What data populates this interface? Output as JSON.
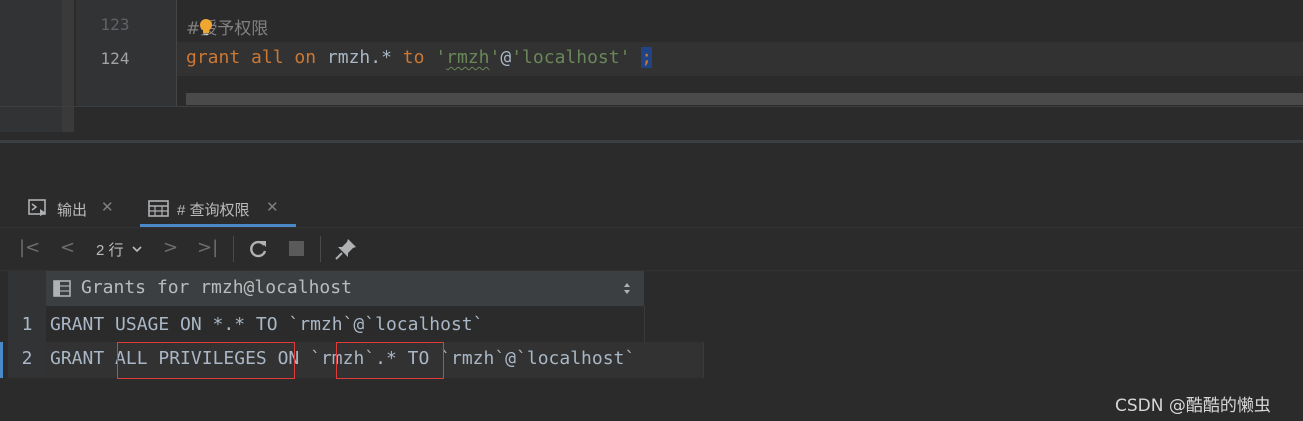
{
  "editor": {
    "lines": [
      {
        "number": "123",
        "text": "#授予权限"
      },
      {
        "number": "124",
        "tokens": {
          "kw1": "grant",
          "kw2": "all",
          "kw3": "on",
          "obj": "rmzh.*",
          "kw4": "to",
          "q1": "'",
          "user": "rmzh",
          "q2": "'",
          "at": "@",
          "host": "'localhost'",
          "semi": ";"
        }
      }
    ]
  },
  "tabs": [
    {
      "label": "输出",
      "icon": "console-output-icon"
    },
    {
      "label": "# 查询权限",
      "icon": "table-icon",
      "active": true
    }
  ],
  "toolbar": {
    "rows_label": "2 行"
  },
  "grid": {
    "column": "Grants for rmzh@localhost",
    "rows": [
      {
        "num": "1",
        "text": "GRANT USAGE ON *.* TO `rmzh`@`localhost`"
      },
      {
        "num": "2",
        "pre": "GRANT ",
        "hl1": "ALL PRIVILEGES",
        "mid": " ON ",
        "hl2": "`rmzh`.*",
        "post": " TO `rmzh`@`localhost`"
      }
    ]
  },
  "watermark": "CSDN @酷酷的懒虫",
  "colors": {
    "accent": "#4a88c7",
    "keyword": "#cc7832",
    "string": "#6a8759",
    "highlight_box": "#e03c3c"
  }
}
